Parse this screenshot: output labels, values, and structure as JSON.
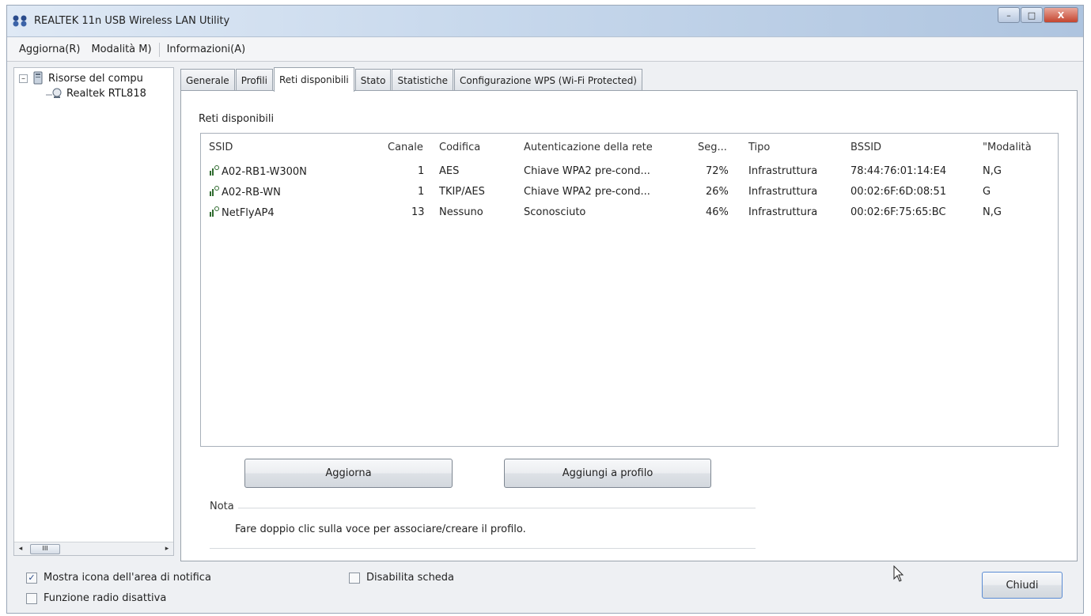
{
  "window": {
    "title": "REALTEK 11n USB Wireless LAN Utility",
    "controls": {
      "minimize": "–",
      "maximize": "□",
      "close": "X"
    }
  },
  "menu": [
    "Aggiorna(R)",
    "Modalità M)",
    "Informazioni(A)"
  ],
  "tree": {
    "root": {
      "expander": "–",
      "label": "Risorse del compu",
      "icon": "computer-icon"
    },
    "child": {
      "label": "Realtek RTL818",
      "icon": "network-adapter-icon"
    },
    "scroll": {
      "left": "◂",
      "thumb": "III",
      "right": "▸"
    }
  },
  "tabs": [
    "Generale",
    "Profili",
    "Reti disponibili",
    "Stato",
    "Statistiche",
    "Configurazione WPS (Wi-Fi Protected)"
  ],
  "active_tab": "Reti disponibili",
  "networks": {
    "label": "Reti disponibili",
    "columns": {
      "ssid": "SSID",
      "channel": "Canale",
      "encoding": "Codifica",
      "auth": "Autenticazione della rete",
      "signal": "Seg...",
      "type": "Tipo",
      "bssid": "BSSID",
      "mode": "\"Modalità"
    },
    "rows": [
      {
        "ssid": "A02-RB1-W300N",
        "channel": "1",
        "encoding": "AES",
        "auth": "Chiave WPA2 pre-cond...",
        "signal": "72%",
        "type": "Infrastruttura",
        "bssid": "78:44:76:01:14:E4",
        "mode": "N,G"
      },
      {
        "ssid": "A02-RB-WN",
        "channel": "1",
        "encoding": "TKIP/AES",
        "auth": "Chiave WPA2 pre-cond...",
        "signal": "26%",
        "type": "Infrastruttura",
        "bssid": "00:02:6F:6D:08:51",
        "mode": "G"
      },
      {
        "ssid": "NetFlyAP4",
        "channel": "13",
        "encoding": "Nessuno",
        "auth": "Sconosciuto",
        "signal": "46%",
        "type": "Infrastruttura",
        "bssid": "00:02:6F:75:65:BC",
        "mode": "N,G"
      }
    ]
  },
  "buttons": {
    "refresh": "Aggiorna",
    "add_profile": "Aggiungi a profilo",
    "close": "Chiudi"
  },
  "note": {
    "label": "Nota",
    "text": "Fare doppio clic sulla voce per associare/creare il profilo."
  },
  "options": {
    "show_tray_icon": {
      "label": "Mostra icona dell'area di notifica",
      "checked": true,
      "mark": "✓"
    },
    "disable_adapter": {
      "label": "Disabilita scheda",
      "checked": false
    },
    "radio_off": {
      "label": "Funzione radio disattiva",
      "checked": false
    }
  },
  "colors": {
    "signal_icon": "#2f6b2f",
    "selected_border": "#5a8bd3"
  }
}
